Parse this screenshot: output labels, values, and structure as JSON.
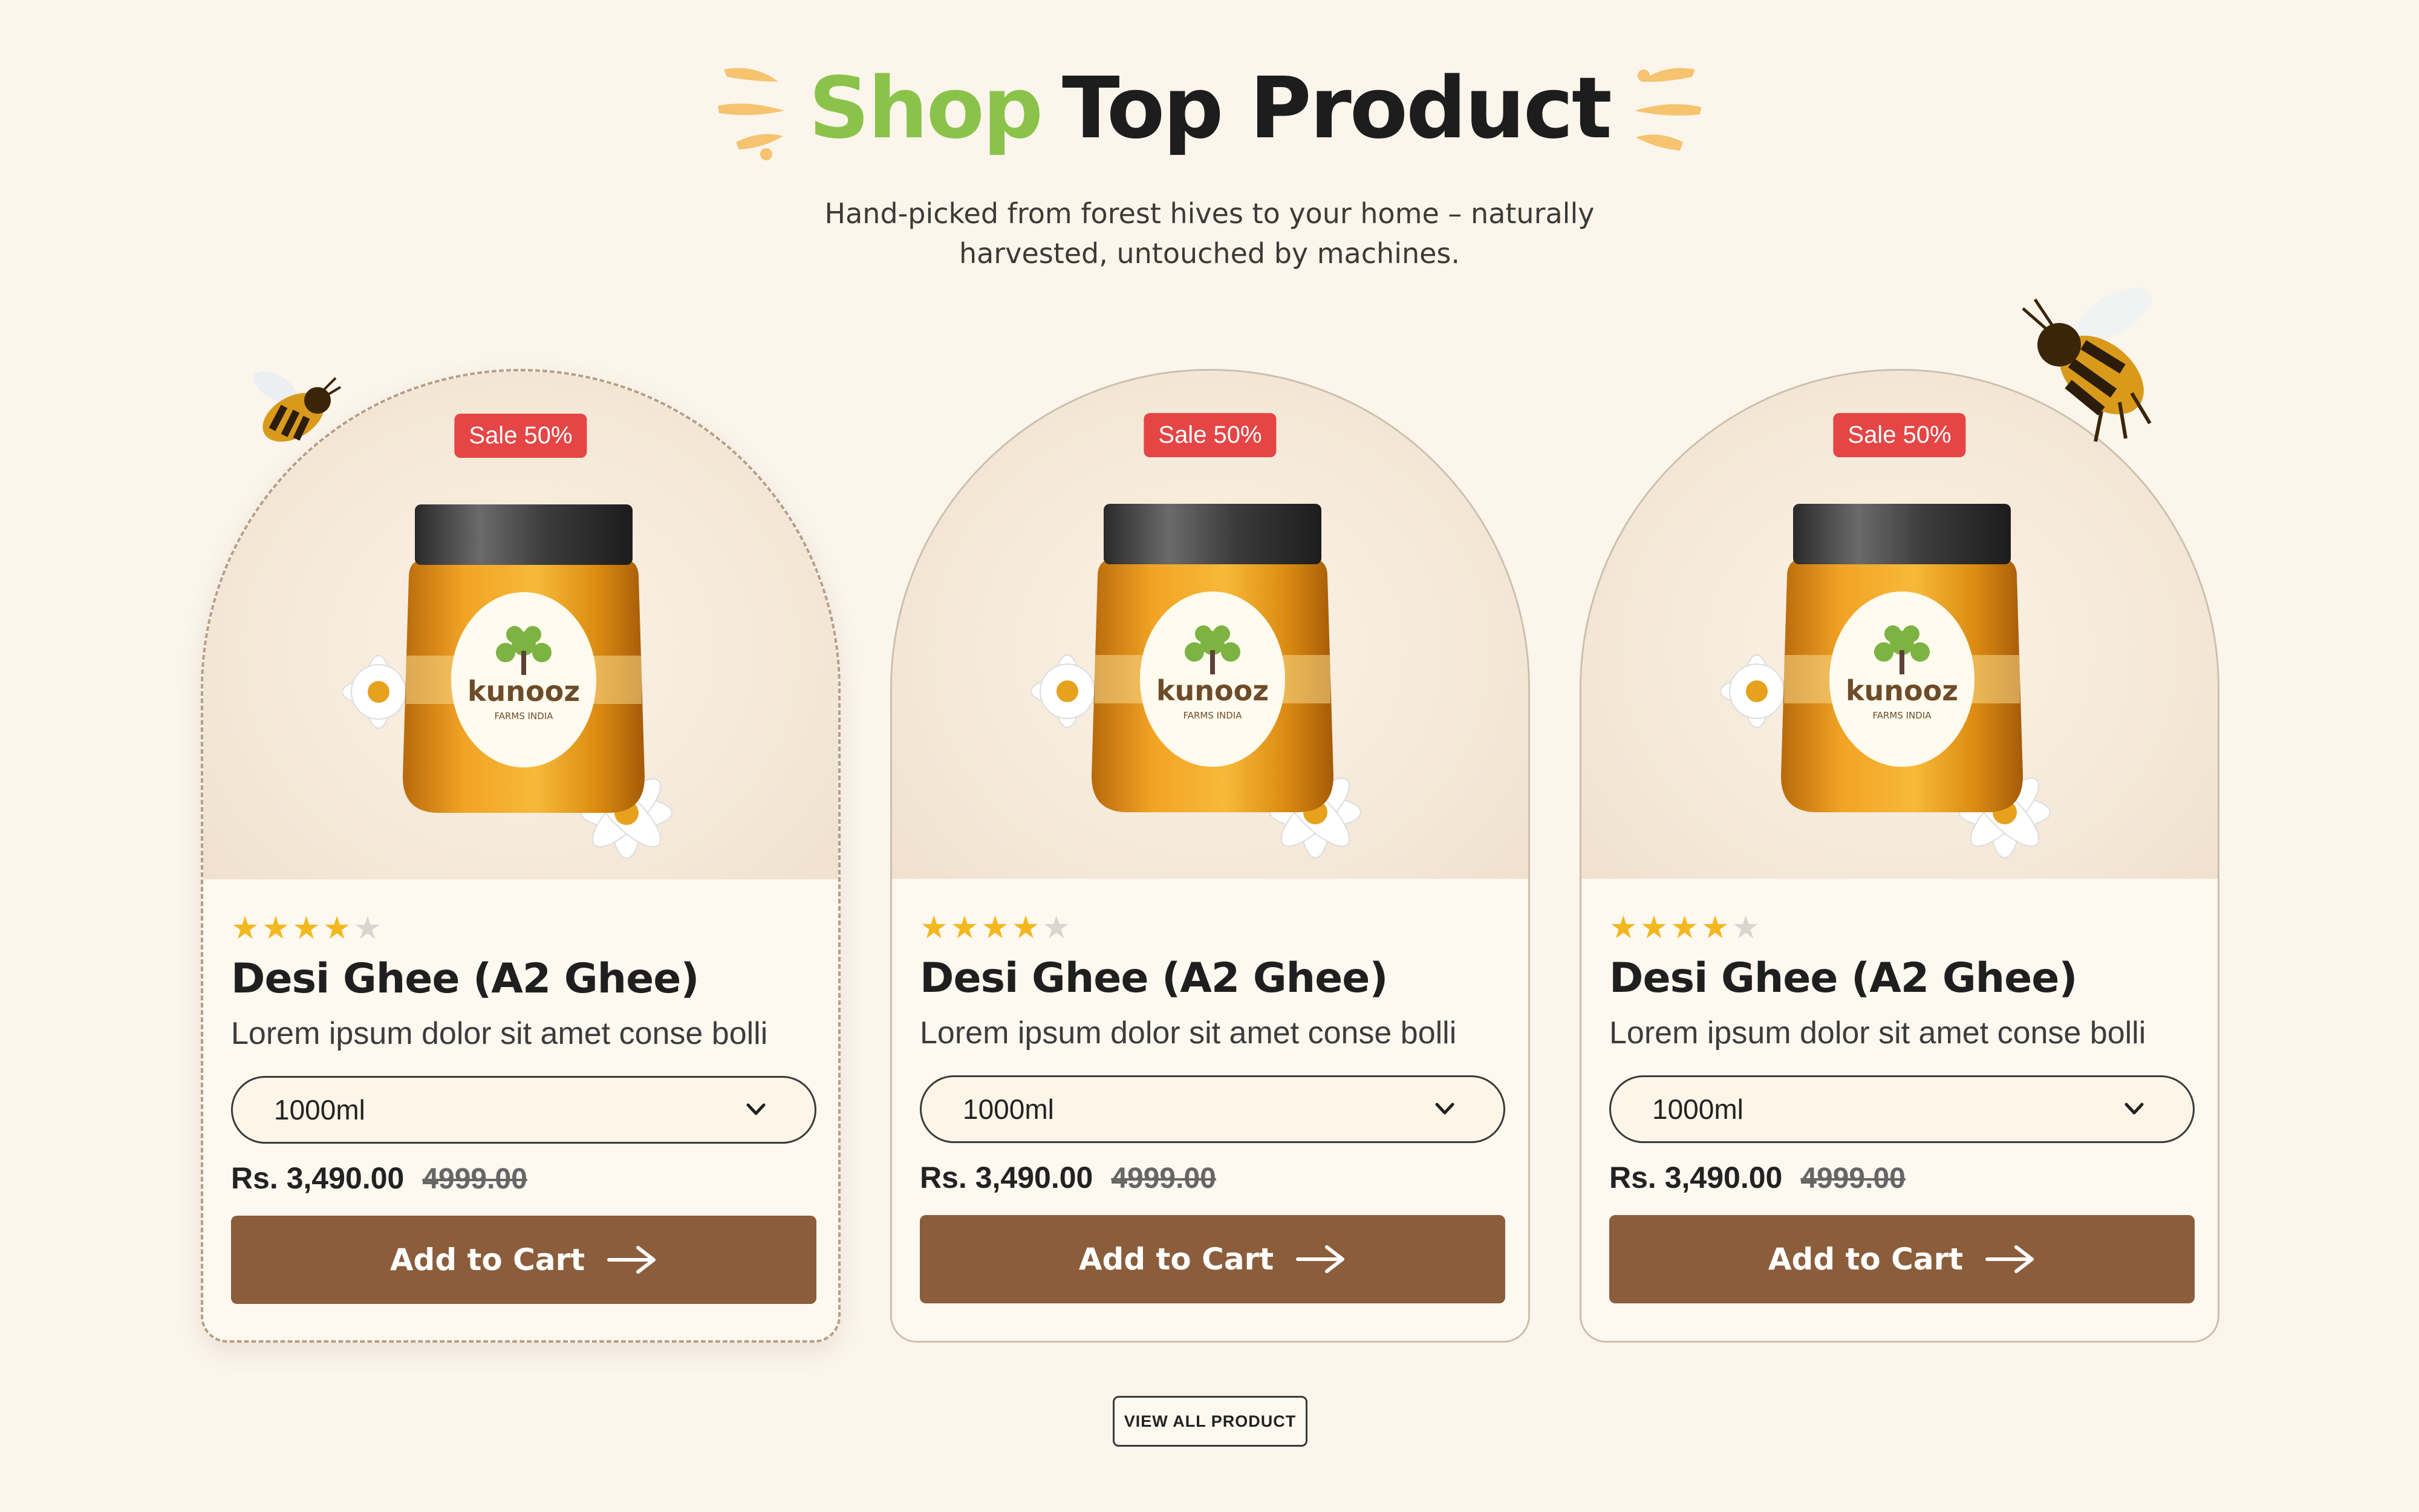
{
  "header": {
    "title_highlight": "Shop",
    "title_rest": "Top Product",
    "subtitle_line1": "Hand-picked from forest hives to your home – naturally",
    "subtitle_line2": "harvested, untouched by machines."
  },
  "products": [
    {
      "badge": "Sale 50%",
      "brand": "kunooz",
      "brand_sub": "FARMS INDIA",
      "rating": 4,
      "title": "Desi Ghee (A2 Ghee)",
      "description": "Lorem ipsum dolor sit amet conse bolli",
      "size": "1000ml",
      "price": "Rs. 3,490.00",
      "old_price": "4999.00",
      "cta": "Add to Cart"
    },
    {
      "badge": "Sale 50%",
      "brand": "kunooz",
      "brand_sub": "FARMS INDIA",
      "rating": 4,
      "title": "Desi Ghee (A2 Ghee)",
      "description": "Lorem ipsum dolor sit amet conse bolli",
      "size": "1000ml",
      "price": "Rs. 3,490.00",
      "old_price": "4999.00",
      "cta": "Add to Cart"
    },
    {
      "badge": "Sale 50%",
      "brand": "kunooz",
      "brand_sub": "FARMS INDIA",
      "rating": 4,
      "title": "Desi Ghee (A2 Ghee)",
      "description": "Lorem ipsum dolor sit amet conse bolli",
      "size": "1000ml",
      "price": "Rs. 3,490.00",
      "old_price": "4999.00",
      "cta": "Add to Cart"
    }
  ],
  "view_all_label": "VIEW ALL PRODUCT",
  "colors": {
    "background": "#fbf5ec",
    "accent_green": "#8bc34a",
    "sale_red": "#e54545",
    "cart_brown": "#8b5d3b",
    "star_gold": "#f2b81e"
  },
  "icons": [
    "splash-icon",
    "star-icon",
    "chevron-down-icon",
    "arrow-right-icon",
    "bee-icon",
    "honey-jar-image"
  ]
}
